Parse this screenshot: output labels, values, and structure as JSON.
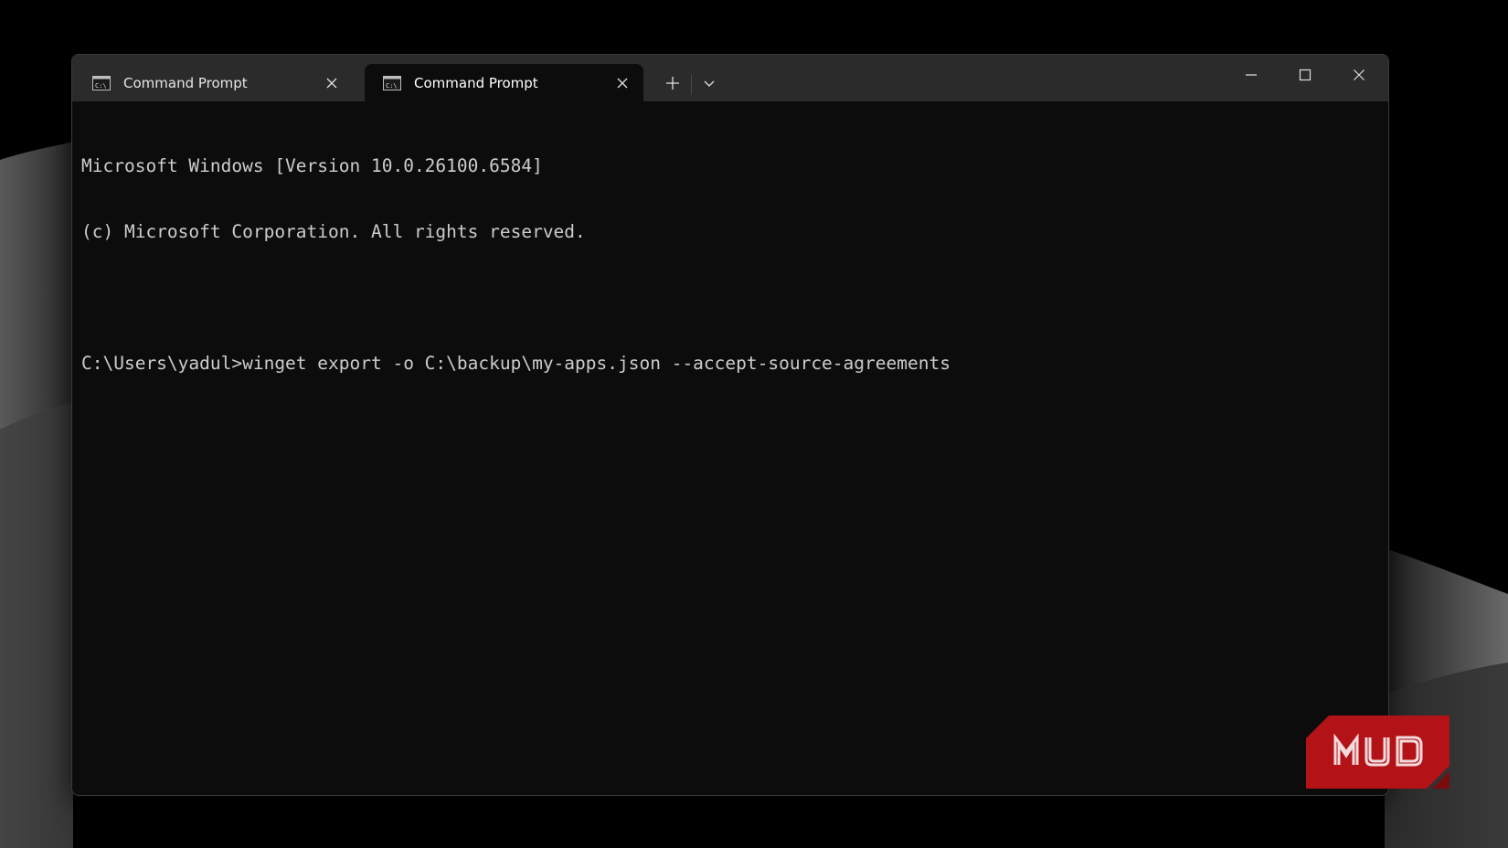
{
  "window": {
    "tabs": [
      {
        "label": "Command Prompt",
        "icon": "cmd-icon",
        "active": false
      },
      {
        "label": "Command Prompt",
        "icon": "cmd-icon",
        "active": true
      }
    ],
    "new_tab_icon": "plus-icon",
    "dropdown_icon": "chevron-down-icon",
    "controls": [
      "minimize-icon",
      "maximize-icon",
      "close-icon"
    ]
  },
  "terminal": {
    "lines": [
      "Microsoft Windows [Version 10.0.26100.6584]",
      "(c) Microsoft Corporation. All rights reserved.",
      "",
      "C:\\Users\\yadul>winget export -o C:\\backup\\my-apps.json --accept-source-agreements"
    ]
  },
  "watermark": {
    "text": "MUO",
    "color": "#b31217"
  },
  "colors": {
    "titlebar": "#2b2b2b",
    "terminal_bg": "#0c0c0c",
    "terminal_fg": "#cccccc"
  }
}
